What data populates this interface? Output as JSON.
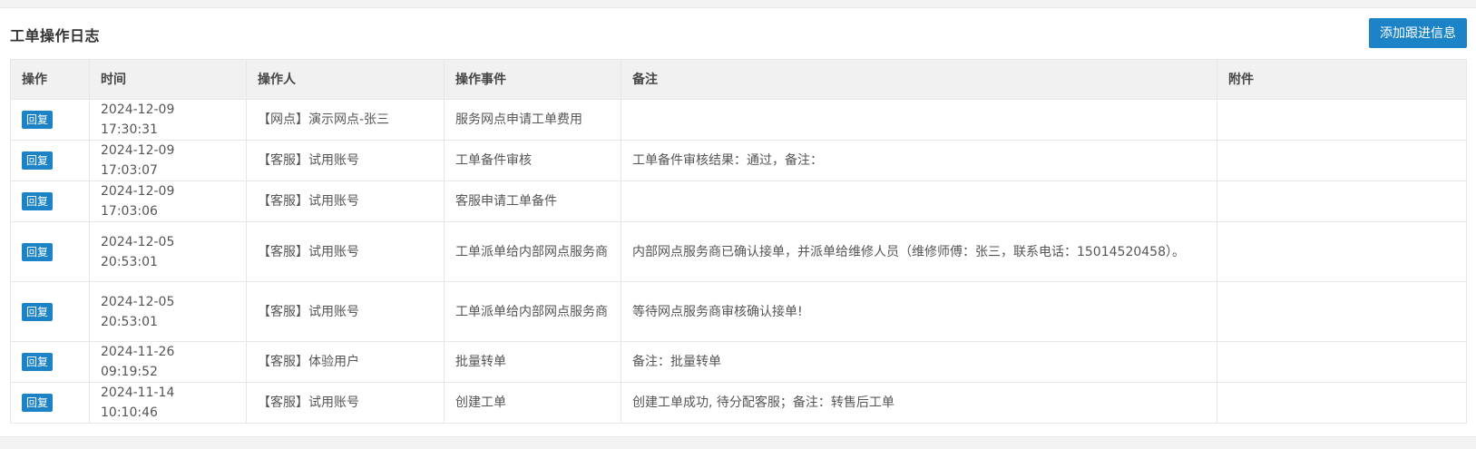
{
  "panel": {
    "title": "工单操作日志",
    "add_button_label": "添加跟进信息"
  },
  "table": {
    "columns": [
      "操作",
      "时间",
      "操作人",
      "操作事件",
      "备注",
      "附件"
    ],
    "rows": [
      {
        "action": "回复",
        "time": "2024-12-09 17:30:31",
        "operator": "【网点】演示网点-张三",
        "event": "服务网点申请工单费用",
        "remark": "",
        "attachment": ""
      },
      {
        "action": "回复",
        "time": "2024-12-09 17:03:07",
        "operator": "【客服】试用账号",
        "event": "工单备件审核",
        "remark": "工单备件审核结果：通过，备注：",
        "attachment": ""
      },
      {
        "action": "回复",
        "time": "2024-12-09 17:03:06",
        "operator": "【客服】试用账号",
        "event": "客服申请工单备件",
        "remark": "",
        "attachment": ""
      },
      {
        "action": "回复",
        "time": "2024-12-05 20:53:01",
        "operator": "【客服】试用账号",
        "event": "工单派单给内部网点服务商",
        "remark": "内部网点服务商已确认接单，并派单给维修人员（维修师傅：张三，联系电话：15014520458）。",
        "attachment": ""
      },
      {
        "action": "回复",
        "time": "2024-12-05 20:53:01",
        "operator": "【客服】试用账号",
        "event": "工单派单给内部网点服务商",
        "remark": "等待网点服务商审核确认接单!",
        "attachment": ""
      },
      {
        "action": "回复",
        "time": "2024-11-26 09:19:52",
        "operator": "【客服】体验用户",
        "event": "批量转单",
        "remark": "备注：批量转单",
        "attachment": ""
      },
      {
        "action": "回复",
        "time": "2024-11-14 10:10:46",
        "operator": "【客服】试用账号",
        "event": "创建工单",
        "remark": "创建工单成功, 待分配客服；备注：转售后工单",
        "attachment": ""
      }
    ]
  },
  "colors": {
    "accent": "#1c84c6",
    "header_bg": "#f1f1f1",
    "border": "#e7e7e7"
  }
}
